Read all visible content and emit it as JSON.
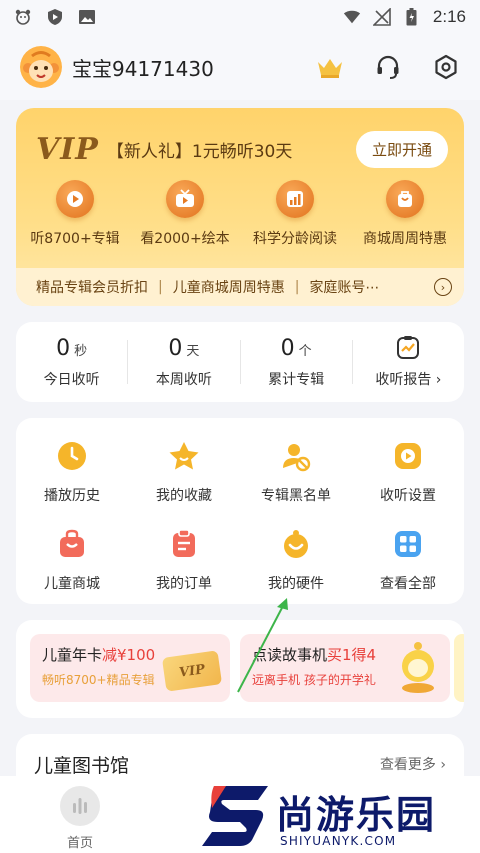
{
  "status_bar": {
    "time": "2:16"
  },
  "header": {
    "username": "宝宝94171430"
  },
  "vip": {
    "logo": "VIP",
    "promo": "【新人礼】1元畅听30天",
    "open_button": "立即开通",
    "benefits": [
      {
        "label": "听8700+专辑",
        "icon": "play-icon"
      },
      {
        "label": "看2000+绘本",
        "icon": "tv-play-icon"
      },
      {
        "label": "科学分龄阅读",
        "icon": "chart-icon"
      },
      {
        "label": "商城周周特惠",
        "icon": "shopping-bag-icon"
      }
    ],
    "strip": [
      "精品专辑会员折扣",
      "儿童商城周周特惠",
      "家庭账号⋯"
    ],
    "strip_separator": "|"
  },
  "stats": [
    {
      "value": "0",
      "unit": "秒",
      "label": "今日收听"
    },
    {
      "value": "0",
      "unit": "天",
      "label": "本周收听"
    },
    {
      "value": "0",
      "unit": "个",
      "label": "累计专辑"
    }
  ],
  "report": {
    "label": "收听报告"
  },
  "grid": [
    {
      "label": "播放历史",
      "icon": "clock-icon"
    },
    {
      "label": "我的收藏",
      "icon": "star-icon"
    },
    {
      "label": "专辑黑名单",
      "icon": "user-block-icon"
    },
    {
      "label": "收听设置",
      "icon": "settings-play-icon"
    },
    {
      "label": "儿童商城",
      "icon": "shopping-bag-icon"
    },
    {
      "label": "我的订单",
      "icon": "order-icon"
    },
    {
      "label": "我的硬件",
      "icon": "smile-device-icon"
    },
    {
      "label": "查看全部",
      "icon": "grid-icon"
    }
  ],
  "promos": [
    {
      "title": "儿童年卡",
      "highlight": "减¥100",
      "sub": "畅听8700+精品专辑",
      "tag": "VIP"
    },
    {
      "title": "点读故事机",
      "highlight": "买1得4",
      "sub": "远离手机 孩子的开学礼"
    }
  ],
  "library": {
    "title": "儿童图书馆",
    "more": "查看更多"
  },
  "tabbar": {
    "home": "首页"
  },
  "watermark": {
    "text": "尚游乐园",
    "url": "SHIYUANYK.COM"
  },
  "colors": {
    "accent": "#f5a623",
    "red": "#e8403b",
    "vip_brown": "#8b5a1c"
  }
}
